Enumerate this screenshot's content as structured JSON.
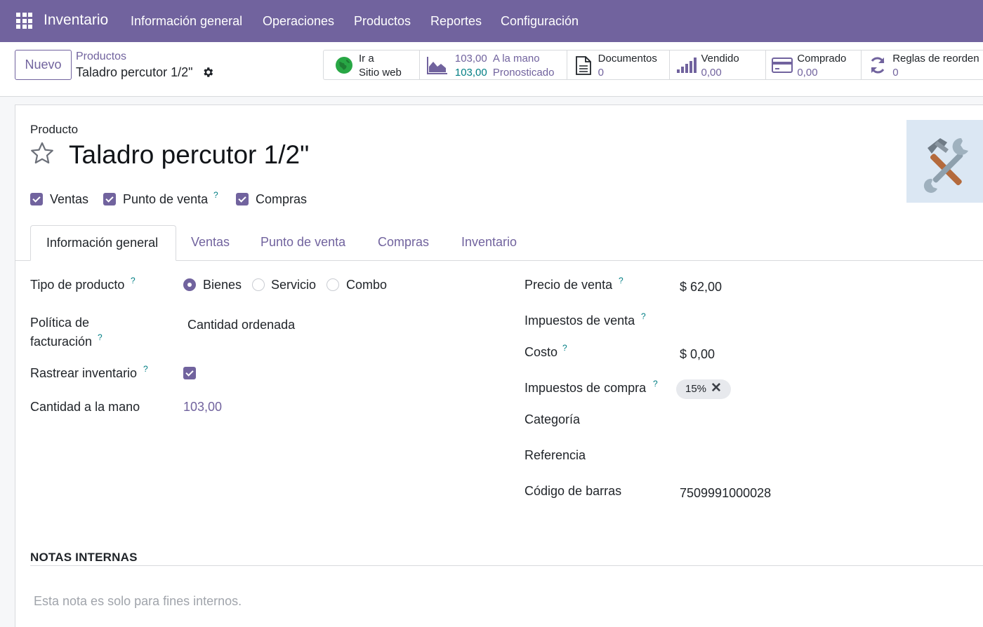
{
  "navbar": {
    "app_name": "Inventario",
    "menu": [
      "Información general",
      "Operaciones",
      "Productos",
      "Reportes",
      "Configuración"
    ],
    "color": "#71639e"
  },
  "control": {
    "new_button": "Nuevo",
    "breadcrumb_parent": "Productos",
    "breadcrumb_current": "Taladro percutor 1/2\"",
    "stats": {
      "website": {
        "line1": "Ir a",
        "line2": "Sitio web"
      },
      "on_hand": {
        "value": "103,00",
        "label": "A la mano"
      },
      "forecast": {
        "value": "103,00",
        "label": "Pronosticado"
      },
      "documents": {
        "label": "Documentos",
        "value": "0"
      },
      "sold": {
        "label": "Vendido",
        "value": "0,00"
      },
      "purchased": {
        "label": "Comprado",
        "value": "0,00"
      },
      "reorder": {
        "label": "Reglas de reorden",
        "value": "0"
      }
    }
  },
  "product": {
    "label": "Producto",
    "name": "Taladro percutor 1/2\"",
    "flags": {
      "sales": "Ventas",
      "pos": "Punto de venta",
      "purchase": "Compras"
    },
    "help_mark": "?"
  },
  "tabs": [
    "Información general",
    "Ventas",
    "Punto de venta",
    "Compras",
    "Inventario"
  ],
  "general": {
    "product_type_label": "Tipo de producto",
    "product_type_options": [
      "Bienes",
      "Servicio",
      "Combo"
    ],
    "product_type_selected": "Bienes",
    "invoice_policy_label_1": "Política de",
    "invoice_policy_label_2": "facturación",
    "invoice_policy_value": "Cantidad ordenada",
    "track_inventory_label": "Rastrear inventario",
    "qty_on_hand_label": "Cantidad a la mano",
    "qty_on_hand_value": "103,00",
    "sale_price_label": "Precio de venta",
    "sale_price_value": "$ 62,00",
    "sale_taxes_label": "Impuestos de venta",
    "cost_label": "Costo",
    "cost_value": "$ 0,00",
    "purchase_taxes_label": "Impuestos de compra",
    "purchase_tax_tag": "15%",
    "category_label": "Categoría",
    "reference_label": "Referencia",
    "barcode_label": "Código de barras",
    "barcode_value": "7509991000028"
  },
  "notes": {
    "heading": "NOTAS INTERNAS",
    "placeholder": "Esta nota es solo para fines internos."
  }
}
